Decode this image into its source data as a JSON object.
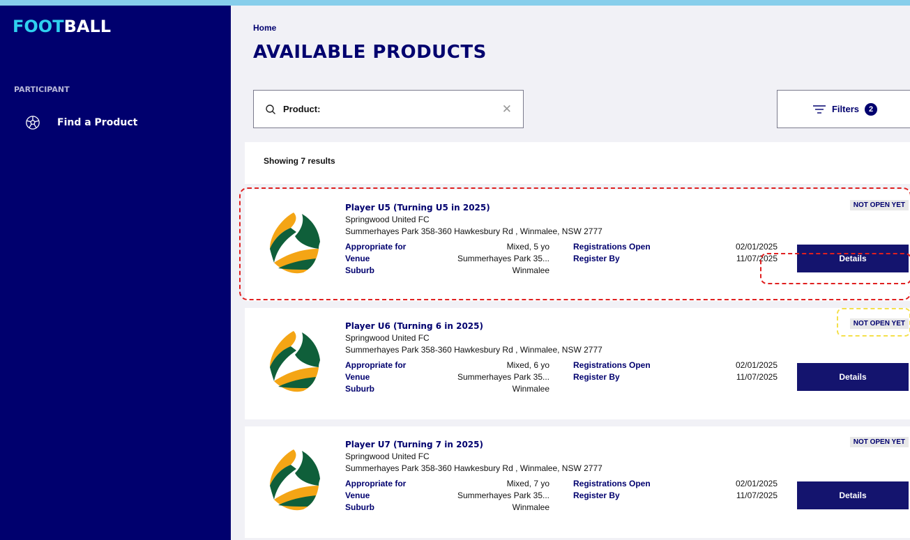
{
  "sidebar": {
    "logo_accent": "FOOT",
    "logo_rest": "BALL",
    "section_label": "PARTICIPANT",
    "nav_items": [
      {
        "label": "Find a Product",
        "icon": "soccer-ball-icon"
      }
    ]
  },
  "main": {
    "breadcrumb": "Home",
    "title": "AVAILABLE PRODUCTS",
    "search": {
      "label": "Product:",
      "icon": "search-icon",
      "clear_icon": "close-icon"
    },
    "filters": {
      "label": "Filters",
      "count": "2",
      "icon": "filter-icon"
    },
    "results_text": "Showing 7 results"
  },
  "products": [
    {
      "name": "Player U5 (Turning U5 in 2025)",
      "club": "Springwood United FC",
      "address": "Summerhayes Park 358-360 Hawkesbury Rd , Winmalee, NSW 2777",
      "status": "NOT OPEN YET",
      "appropriate_label": "Appropriate for",
      "appropriate_value": "Mixed, 5 yo",
      "venue_label": "Venue",
      "venue_value": "Summerhayes Park 35...",
      "suburb_label": "Suburb",
      "suburb_value": "Winmalee",
      "reg_open_label": "Registrations Open",
      "reg_open_date": "02/01/2025",
      "reg_by_label": "Register By",
      "reg_by_date": "11/07/2025",
      "button": "Details"
    },
    {
      "name": "Player U6 (Turning 6 in 2025)",
      "club": "Springwood United FC",
      "address": "Summerhayes Park 358-360 Hawkesbury Rd , Winmalee, NSW 2777",
      "status": "NOT OPEN YET",
      "appropriate_label": "Appropriate for",
      "appropriate_value": "Mixed, 6 yo",
      "venue_label": "Venue",
      "venue_value": "Summerhayes Park 35...",
      "suburb_label": "Suburb",
      "suburb_value": "Winmalee",
      "reg_open_label": "Registrations Open",
      "reg_open_date": "02/01/2025",
      "reg_by_label": "Register By",
      "reg_by_date": "11/07/2025",
      "button": "Details"
    },
    {
      "name": "Player U7 (Turning 7 in 2025)",
      "club": "Springwood United FC",
      "address": "Summerhayes Park 358-360 Hawkesbury Rd , Winmalee, NSW 2777",
      "status": "NOT OPEN YET",
      "appropriate_label": "Appropriate for",
      "appropriate_value": "Mixed, 7 yo",
      "venue_label": "Venue",
      "venue_value": "Summerhayes Park 35...",
      "suburb_label": "Suburb",
      "suburb_value": "Winmalee",
      "reg_open_label": "Registrations Open",
      "reg_open_date": "02/01/2025",
      "reg_by_label": "Register By",
      "reg_by_date": "11/07/2025",
      "button": "Details"
    }
  ],
  "colors": {
    "navy": "#00006e",
    "accent": "#2fd0ef",
    "annotation_red": "#e02020",
    "annotation_yellow": "#f4e04a"
  }
}
